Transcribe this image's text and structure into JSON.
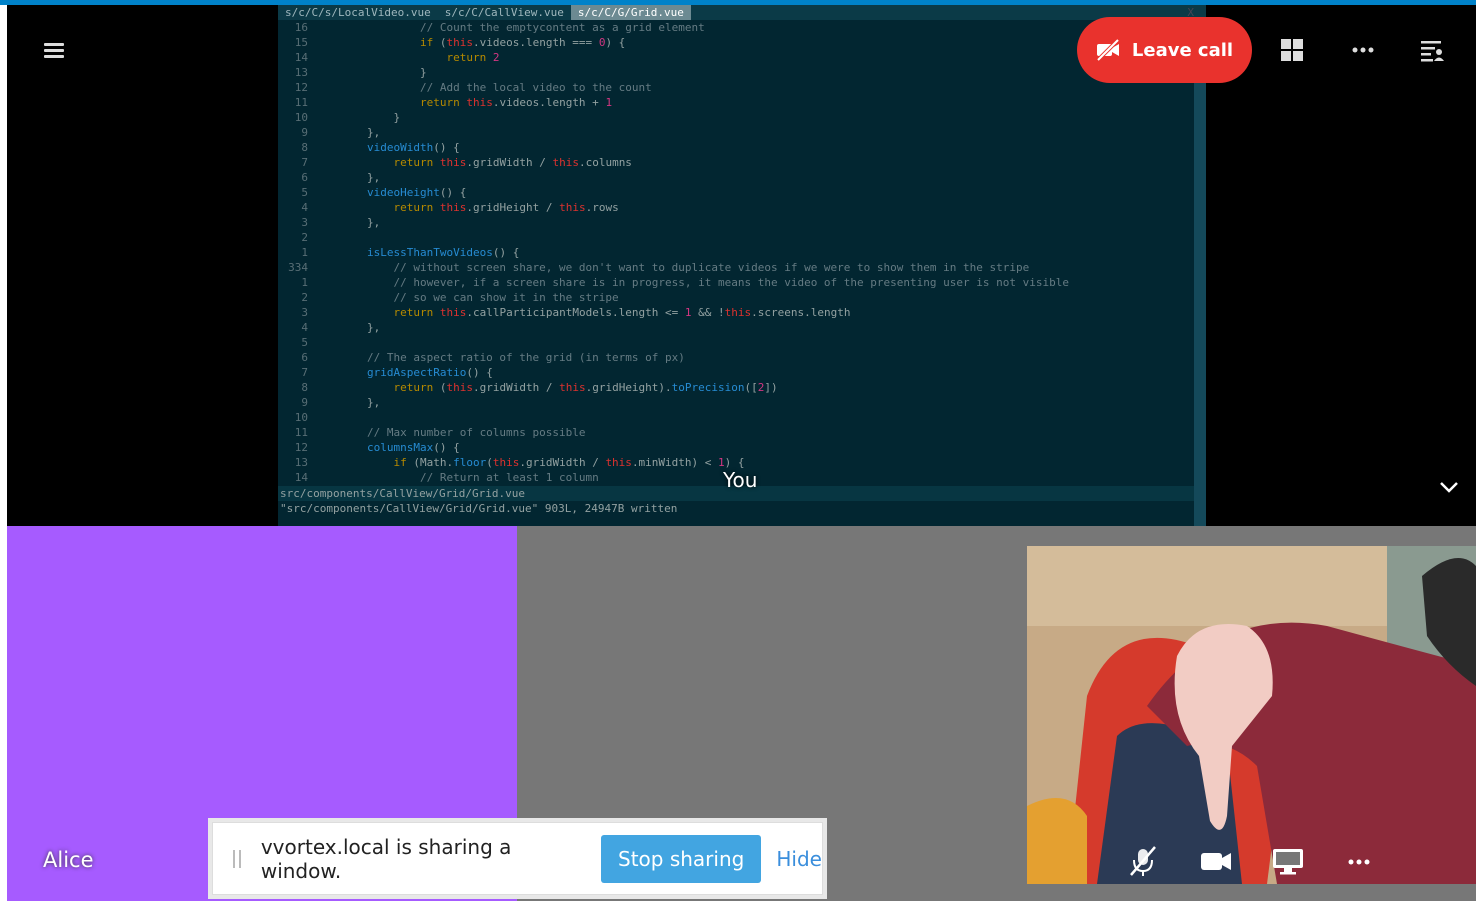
{
  "app": {
    "menu_icon": "hamburger-menu-icon"
  },
  "editor": {
    "tabs": [
      {
        "label": "s/c/C/s/LocalVideo.vue",
        "active": false
      },
      {
        "label": "s/c/C/CallView.vue",
        "active": false
      },
      {
        "label": "s/c/C/G/Grid.vue",
        "active": true
      }
    ],
    "close_label": "X",
    "lines": [
      {
        "n": "16",
        "t": "                // Count the emptycontent as a grid element"
      },
      {
        "n": "15",
        "t": "                if (this.videos.length === 0) {"
      },
      {
        "n": "14",
        "t": "                    return 2"
      },
      {
        "n": "13",
        "t": "                }"
      },
      {
        "n": "12",
        "t": "                // Add the local video to the count"
      },
      {
        "n": "11",
        "t": "                return this.videos.length + 1"
      },
      {
        "n": "10",
        "t": "            }"
      },
      {
        "n": "9",
        "t": "        },"
      },
      {
        "n": "8",
        "t": "        videoWidth() {"
      },
      {
        "n": "7",
        "t": "            return this.gridWidth / this.columns"
      },
      {
        "n": "6",
        "t": "        },"
      },
      {
        "n": "5",
        "t": "        videoHeight() {"
      },
      {
        "n": "4",
        "t": "            return this.gridHeight / this.rows"
      },
      {
        "n": "3",
        "t": "        },"
      },
      {
        "n": "2",
        "t": ""
      },
      {
        "n": "1",
        "t": "        isLessThanTwoVideos() {"
      },
      {
        "n": "334",
        "t": "            // without screen share, we don't want to duplicate videos if we were to show them in the stripe"
      },
      {
        "n": "1",
        "t": "            // however, if a screen share is in progress, it means the video of the presenting user is not visible"
      },
      {
        "n": "2",
        "t": "            // so we can show it in the stripe"
      },
      {
        "n": "3",
        "t": "            return this.callParticipantModels.length <= 1 && !this.screens.length"
      },
      {
        "n": "4",
        "t": "        },"
      },
      {
        "n": "5",
        "t": ""
      },
      {
        "n": "6",
        "t": "        // The aspect ratio of the grid (in terms of px)"
      },
      {
        "n": "7",
        "t": "        gridAspectRatio() {"
      },
      {
        "n": "8",
        "t": "            return (this.gridWidth / this.gridHeight).toPrecision([2])"
      },
      {
        "n": "9",
        "t": "        },"
      },
      {
        "n": "10",
        "t": ""
      },
      {
        "n": "11",
        "t": "        // Max number of columns possible"
      },
      {
        "n": "12",
        "t": "        columnsMax() {"
      },
      {
        "n": "13",
        "t": "            if (Math.floor(this.gridWidth / this.minWidth) < 1) {"
      },
      {
        "n": "14",
        "t": "                // Return at least 1 column"
      }
    ],
    "status_line": "src/components/CallView/Grid/Grid.vue",
    "message_line": "\"src/components/CallView/Grid/Grid.vue\" 903L, 24947B written"
  },
  "call": {
    "leave_label": "Leave call",
    "leave_color": "#e9322d",
    "you_label": "You",
    "participant_name": "Alice",
    "participant_color": "#a65bff"
  },
  "share_bar": {
    "text": "vvortex.local is sharing a window.",
    "stop_label": "Stop sharing",
    "hide_label": "Hide",
    "accent": "#42a5e1"
  }
}
